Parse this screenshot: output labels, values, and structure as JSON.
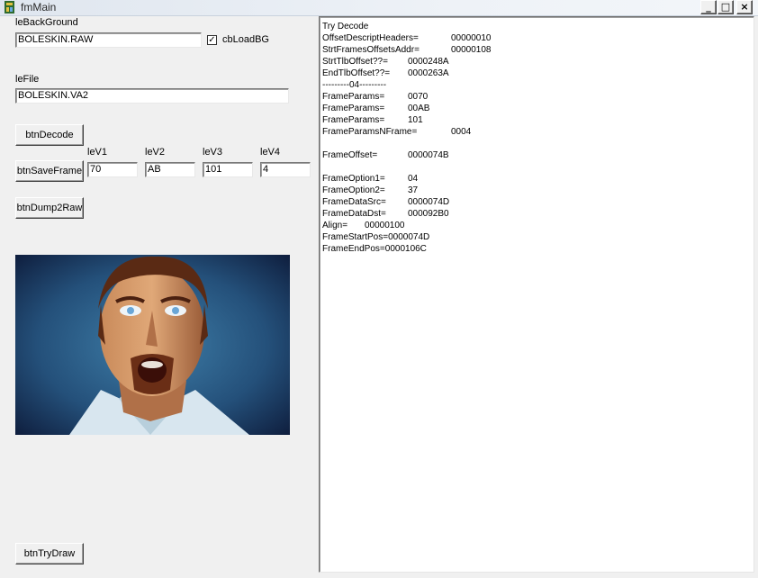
{
  "window": {
    "title": "fmMain",
    "controls": [
      "_",
      "□",
      "×"
    ]
  },
  "background": {
    "label": "leBackGround",
    "value": "BOLESKIN.RAW",
    "checkbox_label": "cbLoadBG",
    "checked": true
  },
  "file": {
    "label": "leFile",
    "value": "BOLESKIN.VA2"
  },
  "buttons": {
    "decode": "btnDecode",
    "save_frame": "btnSaveFrame",
    "dump2raw": "btnDump2Raw",
    "try_draw": "btnTryDraw"
  },
  "params": [
    {
      "label": "leV1",
      "value": "70"
    },
    {
      "label": "leV2",
      "value": "AB"
    },
    {
      "label": "leV3",
      "value": "101"
    },
    {
      "label": "leV4",
      "value": "4"
    }
  ],
  "log": {
    "heading": "Try Decode",
    "lines": [
      {
        "key": "OffsetDescriptHeaders=",
        "value": "00000010"
      },
      {
        "key": "StrtFramesOffsetsAddr=",
        "value": "00000108"
      },
      {
        "key": "StrtTlbOffset??=",
        "value": "0000248A"
      },
      {
        "key": "EndTlbOffset??=",
        "value": "0000263A"
      },
      {
        "key": "---------04---------",
        "value": ""
      },
      {
        "key": "FrameParams=",
        "value": "0070"
      },
      {
        "key": "FrameParams=",
        "value": "00AB"
      },
      {
        "key": "FrameParams=",
        "value": "101"
      },
      {
        "key": "FrameParamsNFrame=",
        "value": "0004"
      },
      {
        "key": "",
        "value": ""
      },
      {
        "key": "FrameOffset=",
        "value": "0000074B"
      },
      {
        "key": "",
        "value": ""
      },
      {
        "key": "FrameOption1=",
        "value": "04"
      },
      {
        "key": "FrameOption2=",
        "value": "37"
      },
      {
        "key": "FrameDataSrc=",
        "value": "0000074D"
      },
      {
        "key": "FrameDataDst=",
        "value": "000092B0"
      },
      {
        "key": "Align=",
        "value": "00000100"
      },
      {
        "key": "FrameStartPos=0000074D",
        "value": ""
      },
      {
        "key": "FrameEndPos=0000106C",
        "value": ""
      }
    ]
  },
  "image": {
    "icon": "face-portrait-image"
  }
}
